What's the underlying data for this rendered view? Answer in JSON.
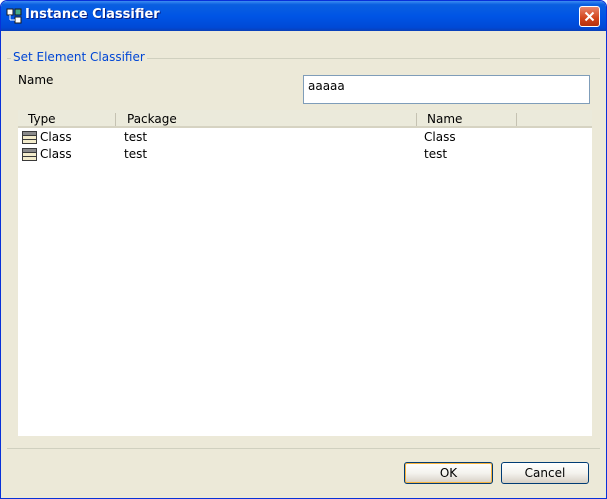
{
  "window": {
    "title": "Instance Classifier"
  },
  "group": {
    "label": "Set Element Classifier"
  },
  "name_field": {
    "label": "Name",
    "value": "aaaaa"
  },
  "table": {
    "headers": [
      "Type",
      "Package",
      "Name"
    ],
    "rows": [
      {
        "type": "Class",
        "package": "test",
        "name": "Class"
      },
      {
        "type": "Class",
        "package": "test",
        "name": "test"
      }
    ]
  },
  "buttons": {
    "ok": "OK",
    "cancel": "Cancel"
  }
}
